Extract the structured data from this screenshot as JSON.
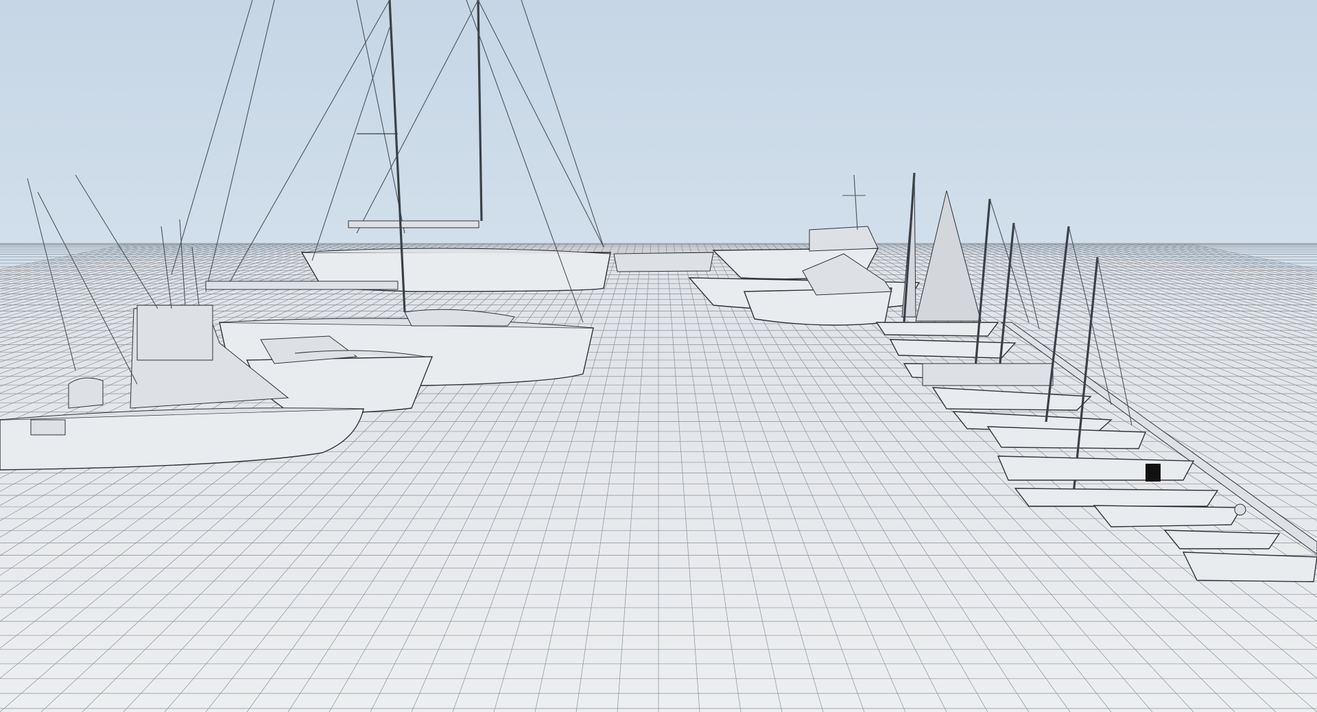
{
  "scene": {
    "sky_color": "#c9d8e6",
    "ground_color": "#e6e8eb",
    "grid_color": "#8a9098",
    "wire_color": "#2f3338"
  },
  "left_fleet": [
    {
      "type": "sport-fishing-yacht",
      "label": ""
    },
    {
      "type": "express-cruiser",
      "label": ""
    },
    {
      "type": "sailing-yacht-large",
      "label": ""
    },
    {
      "type": "sailing-yacht-rear",
      "label": ""
    }
  ],
  "right_fleet": [
    {
      "type": "flybridge-motor-yacht"
    },
    {
      "type": "sport-fisher"
    },
    {
      "type": "sloop-with-mainsail"
    },
    {
      "type": "daysailer"
    },
    {
      "type": "dinghy-sail"
    },
    {
      "type": "rowboat"
    },
    {
      "type": "small-outboard"
    },
    {
      "type": "skiff"
    }
  ]
}
